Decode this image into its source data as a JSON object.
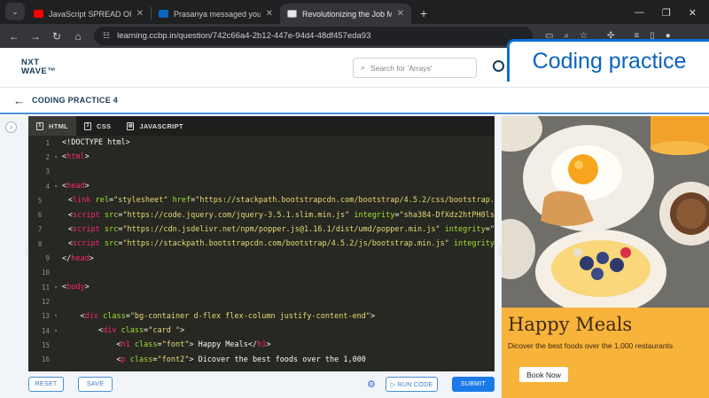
{
  "browser": {
    "tabs": [
      {
        "title": "JavaScript SPREAD OPERATOR |",
        "favicon_color": "#ff0000",
        "active": false
      },
      {
        "title": "Prasanya messaged you",
        "favicon_color": "#0a66c2",
        "active": false
      },
      {
        "title": "Revolutionizing the Job Market",
        "favicon_color": "#e8e8e8",
        "active": true
      }
    ],
    "url": "learning.ccbp.in/question/742c66a4-2b12-447e-94d4-48df457eda93"
  },
  "header": {
    "logo_top": "NXT",
    "logo_bottom": "WAVE™",
    "search_placeholder": "Search for 'Arrays'",
    "banner": "Coding practice"
  },
  "subheader": {
    "title": "CODING PRACTICE 4"
  },
  "editor": {
    "tabs": [
      "HTML",
      "CSS",
      "JAVASCRIPT"
    ],
    "active_tab": "HTML",
    "lines": [
      {
        "n": "1",
        "fold": "",
        "html": "<span class=\"p\">&lt;!DOCTYPE html&gt;</span>"
      },
      {
        "n": "2",
        "fold": "▾",
        "html": "<span class=\"p\">&lt;</span><span class=\"t\">html</span><span class=\"p\">&gt;</span>"
      },
      {
        "n": "3",
        "fold": "",
        "html": ""
      },
      {
        "n": "4",
        "fold": "▾",
        "html": "<span class=\"p\">&lt;</span><span class=\"t\">head</span><span class=\"p\">&gt;</span>"
      },
      {
        "n": "5",
        "fold": "",
        "html": "    <span class=\"p\">&lt;</span><span class=\"t\">link</span> <span class=\"a\">rel</span><span class=\"p\">=</span><span class=\"s\">\"stylesheet\"</span> <span class=\"a\">href</span><span class=\"p\">=</span><span class=\"s\">\"https://stackpath.bootstrapcdn.com/bootstrap/4.5.2/css/bootstrap.</span>"
      },
      {
        "n": "6",
        "fold": "",
        "html": "    <span class=\"p\">&lt;</span><span class=\"t\">script</span> <span class=\"a\">src</span><span class=\"p\">=</span><span class=\"s\">\"https://code.jquery.com/jquery-3.5.1.slim.min.js\"</span> <span class=\"a\">integrity</span><span class=\"p\">=</span><span class=\"s\">\"sha384-DfXdz2htPH0ls</span>"
      },
      {
        "n": "7",
        "fold": "",
        "html": "    <span class=\"p\">&lt;</span><span class=\"t\">script</span> <span class=\"a\">src</span><span class=\"p\">=</span><span class=\"s\">\"https://cdn.jsdelivr.net/npm/popper.js@1.16.1/dist/umd/popper.min.js\"</span> <span class=\"a\">integrity</span><span class=\"p\">=</span><span class=\"s\">\"</span>"
      },
      {
        "n": "8",
        "fold": "",
        "html": "    <span class=\"p\">&lt;</span><span class=\"t\">script</span> <span class=\"a\">src</span><span class=\"p\">=</span><span class=\"s\">\"https://stackpath.bootstrapcdn.com/bootstrap/4.5.2/js/bootstrap.min.js\"</span> <span class=\"a\">integrity</span>"
      },
      {
        "n": "9",
        "fold": "",
        "html": "<span class=\"p\">&lt;/</span><span class=\"t\">head</span><span class=\"p\">&gt;</span>"
      },
      {
        "n": "10",
        "fold": "",
        "html": ""
      },
      {
        "n": "11",
        "fold": "▾",
        "html": "<span class=\"p\">&lt;</span><span class=\"t\">body</span><span class=\"p\">&gt;</span>"
      },
      {
        "n": "12",
        "fold": "",
        "html": ""
      },
      {
        "n": "13",
        "fold": "▾",
        "html": "    <span class=\"p\">&lt;</span><span class=\"t\">div</span> <span class=\"a\">class</span><span class=\"p\">=</span><span class=\"s\">\"bg-container d-flex flex-column justify-content-end\"</span><span class=\"p\">&gt;</span>"
      },
      {
        "n": "14",
        "fold": "▾",
        "html": "        <span class=\"p\">&lt;</span><span class=\"t\">div</span> <span class=\"a\">class</span><span class=\"p\">=</span><span class=\"s\">\"card \"</span><span class=\"p\">&gt;</span>"
      },
      {
        "n": "15",
        "fold": "",
        "html": "            <span class=\"p\">&lt;</span><span class=\"t\">h1</span> <span class=\"a\">class</span><span class=\"p\">=</span><span class=\"s\">\"font\"</span><span class=\"p\">&gt; Happy Meals&lt;/</span><span class=\"t\">h1</span><span class=\"p\">&gt;</span>"
      },
      {
        "n": "16",
        "fold": "",
        "html": "            <span class=\"p\">&lt;</span><span class=\"t\">p</span> <span class=\"a\">class</span><span class=\"p\">=</span><span class=\"s\">\"font2\"</span><span class=\"p\">&gt; Dicover the best foods over the 1,000</span>"
      }
    ]
  },
  "footer": {
    "reset": "RESET",
    "save": "SAVE",
    "run": "▷ RUN CODE",
    "submit": "SUBMIT"
  },
  "preview": {
    "title": "Happy Meals",
    "subtitle": "Dicover the best foods over the 1,000 restaurants",
    "button": "Book Now"
  }
}
